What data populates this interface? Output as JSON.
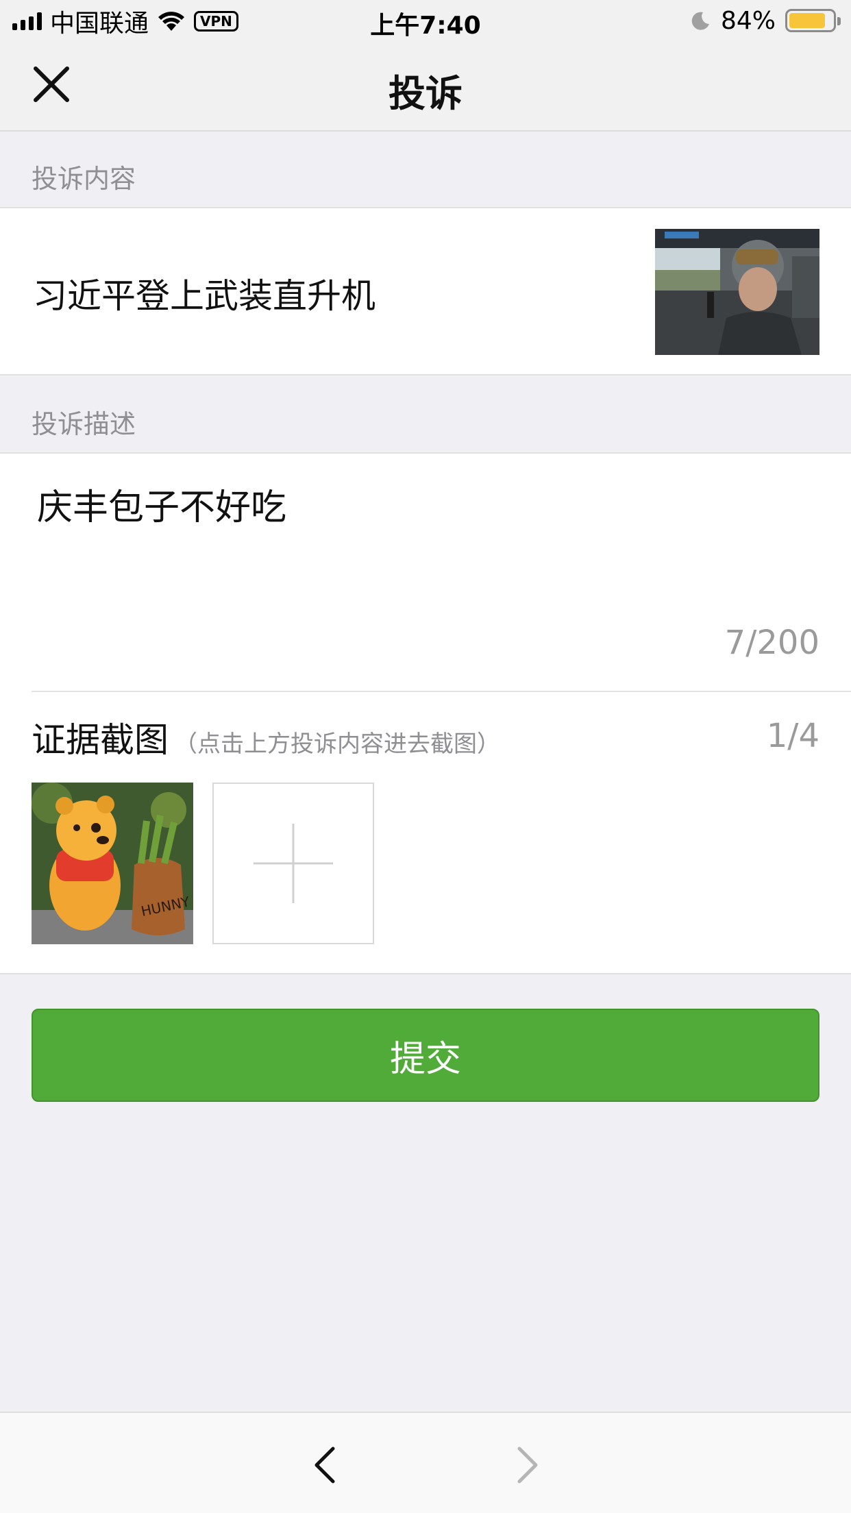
{
  "status": {
    "carrier": "中国联通",
    "vpn": "VPN",
    "time": "上午7:40",
    "battery": "84%",
    "battery_level": 0.84,
    "battery_color": "#f6c53a"
  },
  "nav": {
    "title": "投诉",
    "close_icon": "close-icon"
  },
  "complaint_content": {
    "label": "投诉内容",
    "title": "习近平登上武装直升机",
    "thumbnail": "helicopter-photo"
  },
  "description": {
    "label": "投诉描述",
    "text": "庆丰包子不好吃",
    "counter": "7/200"
  },
  "evidence": {
    "title": "证据截图",
    "hint": "（点击上方投诉内容进去截图）",
    "count": "1/4",
    "image": "winnie-the-pooh-photo",
    "pot_text": "HUNNY",
    "add_icon": "plus-icon"
  },
  "submit": {
    "label": "提交",
    "color": "#51ab38"
  },
  "toolbar": {
    "back_icon": "chevron-left-icon",
    "forward_icon": "chevron-right-icon"
  }
}
